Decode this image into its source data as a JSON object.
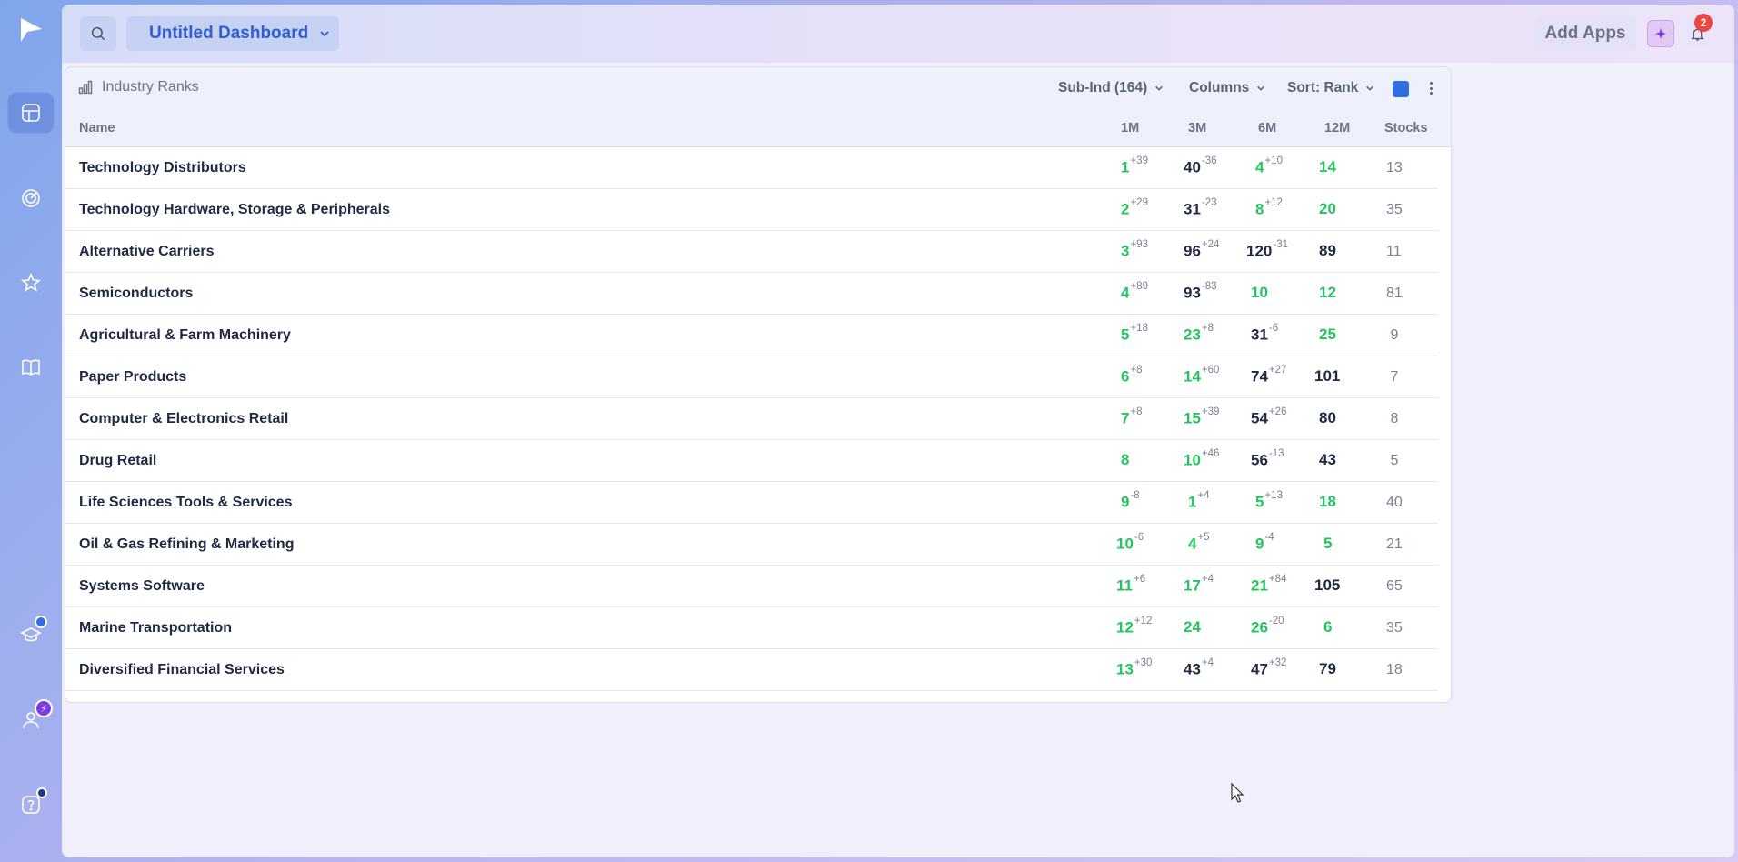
{
  "dashboard": {
    "title": "Untitled Dashboard"
  },
  "topbar": {
    "add_apps_label": "Add Apps",
    "notifications_count": "2"
  },
  "widget": {
    "title": "Industry Ranks",
    "controls": {
      "grouping": "Sub-Ind (164)",
      "columns": "Columns",
      "sort": "Sort: Rank"
    },
    "accent_color": "#2f6fe0"
  },
  "table": {
    "headers": {
      "name": "Name",
      "m1": "1M",
      "m3": "3M",
      "m6": "6M",
      "m12": "12M",
      "stocks": "Stocks"
    },
    "rows": [
      {
        "name": "Technology Distributors",
        "m1": "1",
        "m1d": "+39",
        "m1c": "green",
        "m3": "40",
        "m3d": "-36",
        "m3c": "dark",
        "m6": "4",
        "m6d": "+10",
        "m6c": "green",
        "m12": "14",
        "m12c": "green",
        "stocks": "13"
      },
      {
        "name": "Technology Hardware, Storage & Peripherals",
        "m1": "2",
        "m1d": "+29",
        "m1c": "green",
        "m3": "31",
        "m3d": "-23",
        "m3c": "dark",
        "m6": "8",
        "m6d": "+12",
        "m6c": "green",
        "m12": "20",
        "m12c": "green",
        "stocks": "35"
      },
      {
        "name": "Alternative Carriers",
        "m1": "3",
        "m1d": "+93",
        "m1c": "green",
        "m3": "96",
        "m3d": "+24",
        "m3c": "dark",
        "m6": "120",
        "m6d": "-31",
        "m6c": "dark",
        "m12": "89",
        "m12c": "dark",
        "stocks": "11"
      },
      {
        "name": "Semiconductors",
        "m1": "4",
        "m1d": "+89",
        "m1c": "green",
        "m3": "93",
        "m3d": "-83",
        "m3c": "dark",
        "m6": "10",
        "m6d": "",
        "m6c": "green",
        "m12": "12",
        "m12c": "green",
        "stocks": "81"
      },
      {
        "name": "Agricultural & Farm Machinery",
        "m1": "5",
        "m1d": "+18",
        "m1c": "green",
        "m3": "23",
        "m3d": "+8",
        "m3c": "green",
        "m6": "31",
        "m6d": "-6",
        "m6c": "dark",
        "m12": "25",
        "m12c": "green",
        "stocks": "9"
      },
      {
        "name": "Paper Products",
        "m1": "6",
        "m1d": "+8",
        "m1c": "green",
        "m3": "14",
        "m3d": "+60",
        "m3c": "green",
        "m6": "74",
        "m6d": "+27",
        "m6c": "dark",
        "m12": "101",
        "m12c": "dark",
        "stocks": "7"
      },
      {
        "name": "Computer & Electronics Retail",
        "m1": "7",
        "m1d": "+8",
        "m1c": "green",
        "m3": "15",
        "m3d": "+39",
        "m3c": "green",
        "m6": "54",
        "m6d": "+26",
        "m6c": "dark",
        "m12": "80",
        "m12c": "dark",
        "stocks": "8"
      },
      {
        "name": "Drug Retail",
        "m1": "8",
        "m1d": "",
        "m1c": "green",
        "m3": "10",
        "m3d": "+46",
        "m3c": "green",
        "m6": "56",
        "m6d": "-13",
        "m6c": "dark",
        "m12": "43",
        "m12c": "dark",
        "stocks": "5"
      },
      {
        "name": "Life Sciences Tools & Services",
        "m1": "9",
        "m1d": "-8",
        "m1c": "green",
        "m3": "1",
        "m3d": "+4",
        "m3c": "green",
        "m6": "5",
        "m6d": "+13",
        "m6c": "green",
        "m12": "18",
        "m12c": "green",
        "stocks": "40"
      },
      {
        "name": "Oil & Gas Refining & Marketing",
        "m1": "10",
        "m1d": "-6",
        "m1c": "green",
        "m3": "4",
        "m3d": "+5",
        "m3c": "green",
        "m6": "9",
        "m6d": "-4",
        "m6c": "green",
        "m12": "5",
        "m12c": "green",
        "stocks": "21"
      },
      {
        "name": "Systems Software",
        "m1": "11",
        "m1d": "+6",
        "m1c": "green",
        "m3": "17",
        "m3d": "+4",
        "m3c": "green",
        "m6": "21",
        "m6d": "+84",
        "m6c": "green",
        "m12": "105",
        "m12c": "dark",
        "stocks": "65"
      },
      {
        "name": "Marine Transportation",
        "m1": "12",
        "m1d": "+12",
        "m1c": "green",
        "m3": "24",
        "m3d": "",
        "m3c": "green",
        "m6": "26",
        "m6d": "-20",
        "m6c": "green",
        "m12": "6",
        "m12c": "green",
        "stocks": "35"
      },
      {
        "name": "Diversified Financial Services",
        "m1": "13",
        "m1d": "+30",
        "m1c": "green",
        "m3": "43",
        "m3d": "+4",
        "m3c": "dark",
        "m6": "47",
        "m6d": "+32",
        "m6c": "dark",
        "m12": "79",
        "m12c": "dark",
        "stocks": "18"
      }
    ]
  },
  "colors": {
    "positive": "#22c55e",
    "neutral": "#1e2a44",
    "accent": "#2f5fd1"
  }
}
